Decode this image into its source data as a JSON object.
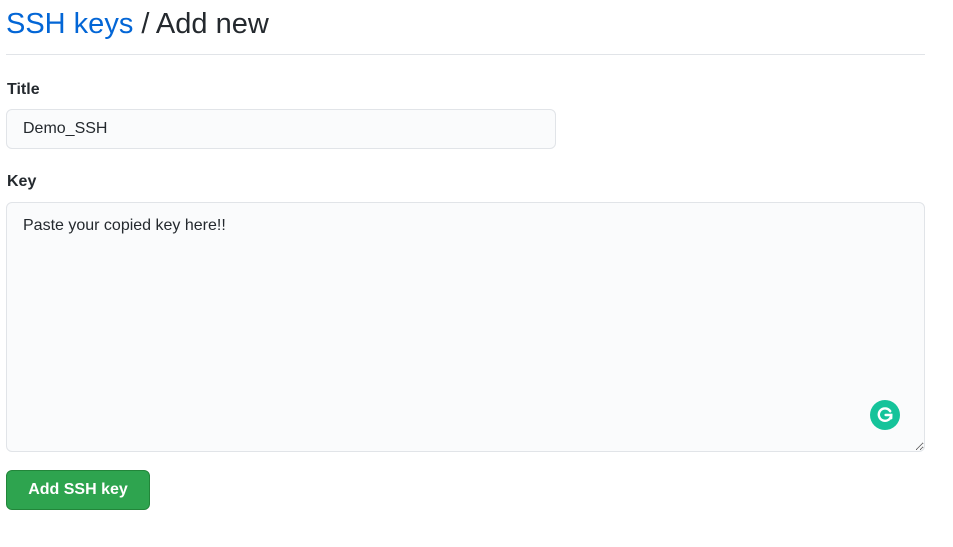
{
  "header": {
    "breadcrumb_link": "SSH keys",
    "separator": " / ",
    "current": "Add new"
  },
  "form": {
    "title_label": "Title",
    "title_value": "Demo_SSH",
    "key_label": "Key",
    "key_value": "Paste your copied key here!!",
    "submit_label": "Add SSH key"
  },
  "icons": {
    "grammarly": "grammarly-icon"
  },
  "colors": {
    "link": "#0366d6",
    "button": "#2ea44f",
    "grammarly": "#15c39a"
  }
}
